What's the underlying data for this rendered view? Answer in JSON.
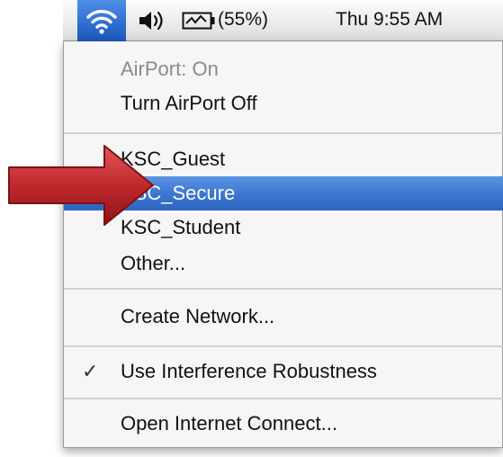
{
  "menubar": {
    "wifi_icon": "wifi-signal-icon",
    "volume_icon": "speaker-volume-icon",
    "battery_icon": "battery-charging-icon",
    "battery_percent": "(55%)",
    "clock": "Thu 9:55 AM"
  },
  "menu": {
    "status": "AirPort: On",
    "toggle": "Turn AirPort Off",
    "networks": [
      "KSC_Guest",
      "KSC_Secure",
      "KSC_Student"
    ],
    "other": "Other...",
    "create_network": "Create Network...",
    "interference": "Use Interference Robustness",
    "interference_checked": "✓",
    "open_connect": "Open Internet Connect..."
  },
  "colors": {
    "selection": "#3a75cf",
    "arrow": "#c0282d"
  },
  "annotation": {
    "arrow_icon": "red-arrow-icon",
    "points_to": "KSC_Secure"
  }
}
